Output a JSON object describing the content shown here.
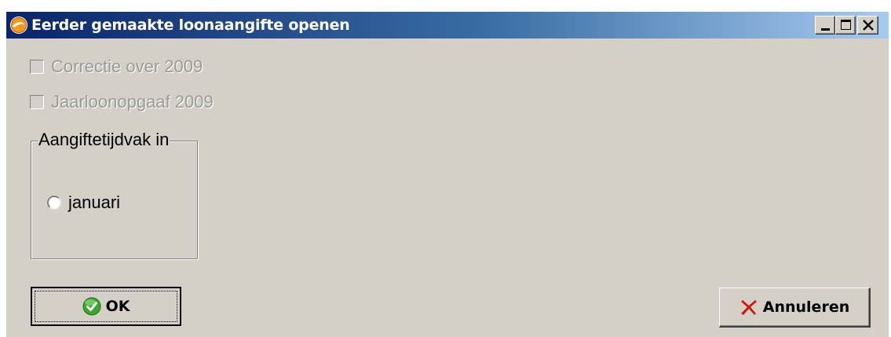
{
  "window": {
    "title": "Eerder gemaakte loonaangifte openen",
    "controls": {
      "minimize_icon": "minimize-icon",
      "maximize_icon": "maximize-icon",
      "close_icon": "close-icon"
    },
    "colors": {
      "titlebar_start": "#0a246a",
      "titlebar_end": "#a6caf0",
      "face": "#d4d0c8"
    }
  },
  "options": {
    "correctie": {
      "label": "Correctie over 2009",
      "checked": false,
      "enabled": false
    },
    "jaarloonopgaaf": {
      "label": "Jaarloonopgaaf 2009",
      "checked": false,
      "enabled": false
    }
  },
  "period_group": {
    "legend": "Aangiftetijdvak in",
    "options": [
      {
        "label": "januari",
        "selected": false
      }
    ]
  },
  "buttons": {
    "ok": {
      "label": "OK",
      "icon": "green-check-icon"
    },
    "cancel": {
      "label": "Annuleren",
      "icon": "red-x-icon"
    }
  }
}
